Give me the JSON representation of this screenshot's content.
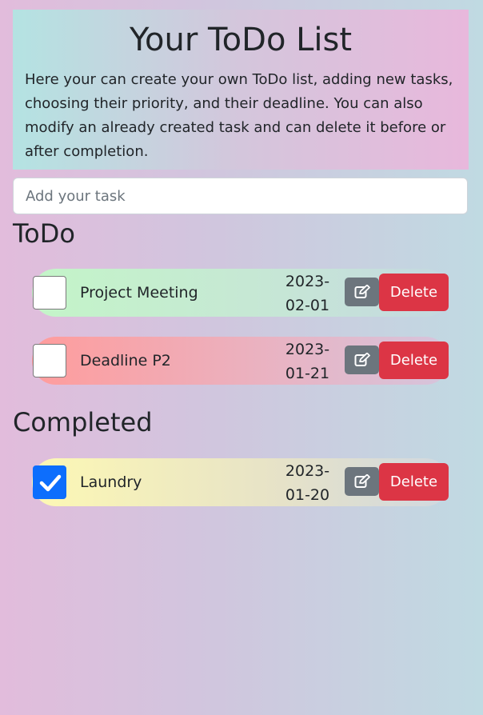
{
  "header": {
    "title": "Your ToDo List",
    "description": "Here your can create your own ToDo list, adding new tasks, choosing their priority, and their deadline. You can also modify an already created task and can delete it before or after completion."
  },
  "input": {
    "placeholder": "Add your task",
    "value": ""
  },
  "sections": {
    "todo_title": "ToDo",
    "completed_title": "Completed"
  },
  "todo": [
    {
      "name": "Project Meeting",
      "date_line1": "2023-",
      "date_line2": "02-01",
      "checked": false,
      "priority_color": "#c4f5c8",
      "delete_label": "Delete"
    },
    {
      "name": "Deadline P2",
      "date_line1": "2023-",
      "date_line2": "01-21",
      "checked": false,
      "priority_color": "#ff9c9c",
      "delete_label": "Delete"
    }
  ],
  "completed": [
    {
      "name": "Laundry",
      "date_line1": "2023-",
      "date_line2": "01-20",
      "checked": true,
      "priority_color": "#fdf8b4",
      "delete_label": "Delete"
    }
  ],
  "colors": {
    "edit_button": "#6c757d",
    "delete_button": "#dc3545",
    "checkbox_checked": "#0d6efd"
  },
  "icons": {
    "edit": "pencil-square-icon",
    "check": "checkmark-icon"
  }
}
